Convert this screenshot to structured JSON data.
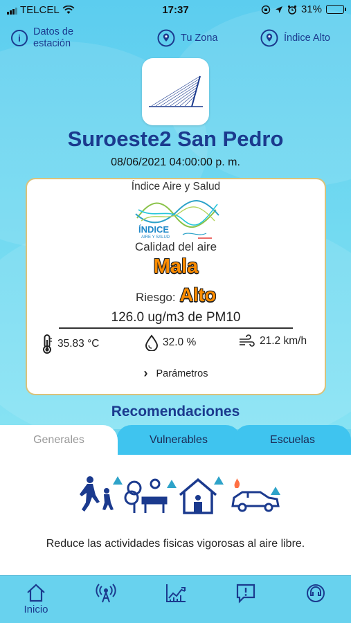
{
  "status_bar": {
    "carrier": "TELCEL",
    "time": "17:37",
    "battery": "31%",
    "battery_level": 0.31
  },
  "top_nav": {
    "station_data": "Datos de estación",
    "station_data_line1": "Datos de",
    "station_data_line2": "estación",
    "your_zone": "Tu Zona",
    "high_index": "Índice Alto"
  },
  "station": {
    "name": "Suroeste2 San Pedro",
    "datetime": "08/06/2021 04:00:00 p. m."
  },
  "card": {
    "heading": "Índice Aire y Salud",
    "brand_text_1": "ÍNDICE",
    "brand_text_2": "AIRE Y SALUD",
    "quality_label": "Calidad del aire",
    "quality_value": "Mala",
    "risk_label": "Riesgo:",
    "risk_value": "Alto",
    "pollutant": "126.0 ug/m3 de PM10",
    "temperature": "35.83 °C",
    "humidity": "32.0 %",
    "wind": "21.2 km/h",
    "params_link": "Parámetros"
  },
  "recommendations": {
    "title": "Recomendaciones",
    "tabs": [
      {
        "label": "Generales",
        "active": true
      },
      {
        "label": "Vulnerables",
        "active": false
      },
      {
        "label": "Escuelas",
        "active": false
      }
    ],
    "text": "Reduce las actividades fisicas vigorosas al aire libre."
  },
  "bottom_nav": {
    "home_label": "Inicio",
    "icons": [
      "home-icon",
      "antenna-icon",
      "trend-chart-icon",
      "alert-message-icon",
      "help-chat-icon"
    ]
  },
  "colors": {
    "primary": "#1b3a8e",
    "quality_accent": "#ff8c00",
    "background": "#6fd6ee",
    "tab_inactive": "#3fc4ef",
    "card_border": "#d9c27a"
  }
}
